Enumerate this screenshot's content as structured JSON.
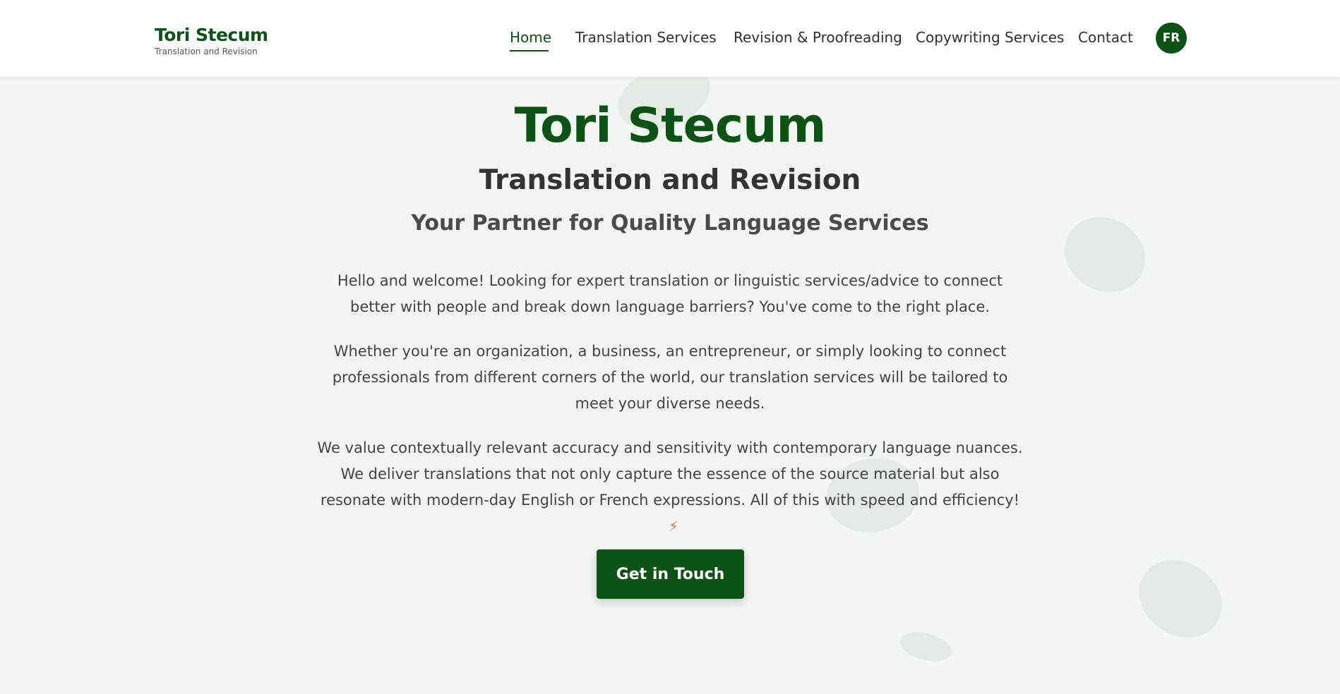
{
  "header": {
    "brand_name": "Tori Stecum",
    "brand_tagline": "Translation and Revision",
    "nav": [
      {
        "label": "Home",
        "active": true
      },
      {
        "label": "Translation Services",
        "active": false
      },
      {
        "label": "Revision & Proofreading",
        "active": false
      },
      {
        "label": "Copywriting Services",
        "active": false
      },
      {
        "label": "Contact",
        "active": false
      }
    ],
    "language_toggle": "FR"
  },
  "hero": {
    "title": "Tori Stecum",
    "subtitle": "Translation and Revision",
    "tagline": "Your Partner for Quality Language Services",
    "paragraphs": [
      "Hello and welcome! Looking for expert translation or linguistic services/advice to connect better with people and break down language barriers? You've come to the right place.",
      "Whether you're an organization, a business, an entrepreneur, or simply looking to connect professionals from different corners of the world, our translation services will be tailored to meet your diverse needs.",
      "We value contextually relevant accuracy and sensitivity with contemporary language nuances. We deliver translations that not only capture the essence of the source material but also resonate with modern-day English or French expressions. All of this with speed and efficiency!"
    ],
    "paragraph_icon": "lightning-bolt-icon",
    "cta_label": "Get in Touch"
  },
  "colors": {
    "brand_green": "#0b5314",
    "background": "#f2f6f2",
    "accent_bolt": "#e8732c"
  }
}
